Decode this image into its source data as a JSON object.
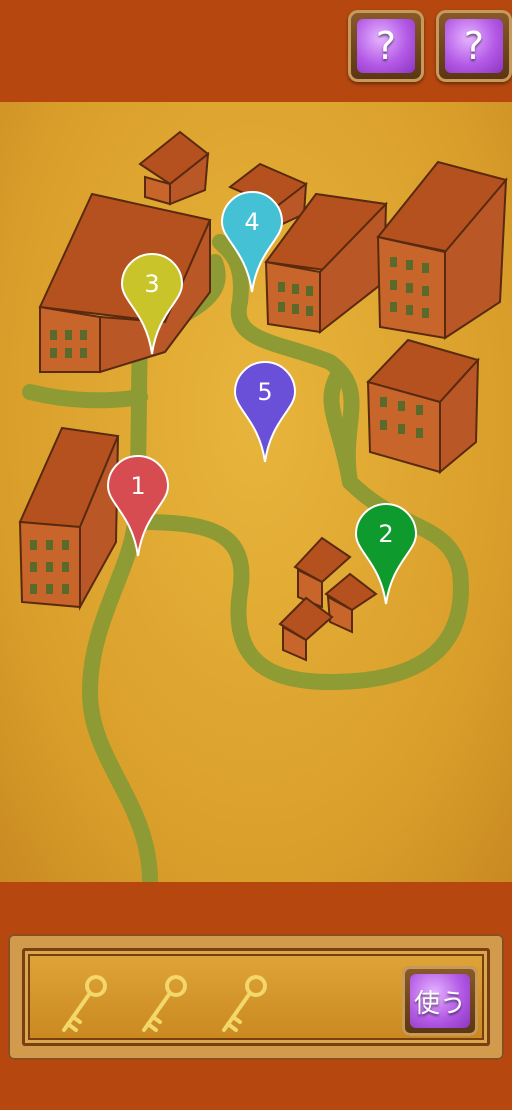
{
  "hints": [
    {
      "label": "?"
    },
    {
      "label": "?"
    }
  ],
  "pins": [
    {
      "label": "1",
      "color": "#d64c50"
    },
    {
      "label": "2",
      "color": "#0f9a2e"
    },
    {
      "label": "3",
      "color": "#c9c42a"
    },
    {
      "label": "4",
      "color": "#45c1d6"
    },
    {
      "label": "5",
      "color": "#6a4fd8"
    }
  ],
  "inventory": {
    "items": [
      {
        "icon": "key-icon"
      },
      {
        "icon": "key-icon"
      },
      {
        "icon": "key-icon"
      }
    ],
    "use_label": "使う"
  }
}
